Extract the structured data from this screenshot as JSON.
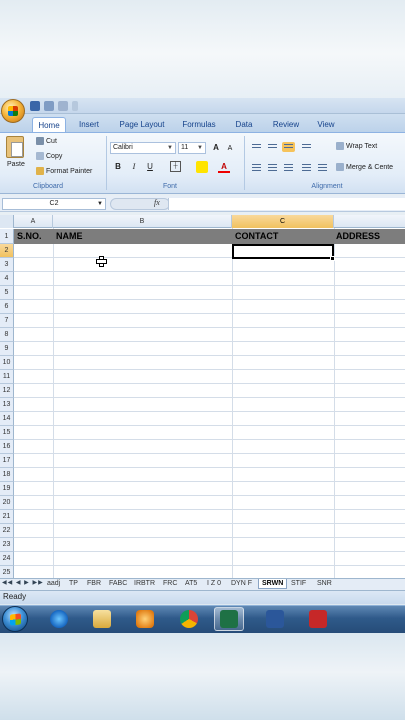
{
  "ribbon": {
    "tabs": [
      {
        "label": "Home"
      },
      {
        "label": "Insert"
      },
      {
        "label": "Page Layout"
      },
      {
        "label": "Formulas"
      },
      {
        "label": "Data"
      },
      {
        "label": "Review"
      },
      {
        "label": "View"
      }
    ],
    "clipboard": {
      "paste": "Paste",
      "cut": "Cut",
      "copy": "Copy",
      "format_painter": "Format Painter",
      "label": "Clipboard"
    },
    "font": {
      "name": "Calibri",
      "size": "11",
      "bold": "B",
      "italic": "I",
      "underline": "U",
      "label": "Font"
    },
    "alignment": {
      "wrap_text": "Wrap Text",
      "merge": "Merge & Cente",
      "label": "Alignment"
    }
  },
  "formula_bar": {
    "name_box": "C2",
    "fx": "fx"
  },
  "grid": {
    "columns": [
      "A",
      "B",
      "C"
    ],
    "rows": [
      "1",
      "2",
      "3",
      "4",
      "5",
      "6",
      "7",
      "8",
      "9",
      "10",
      "11",
      "12",
      "13",
      "14",
      "15",
      "16",
      "17",
      "18",
      "19",
      "20",
      "21",
      "22",
      "23",
      "24",
      "25"
    ],
    "header_cells": {
      "sno": "S.NO.",
      "name": "NAME",
      "contact": "CONTACT",
      "address": "ADDRESS"
    }
  },
  "sheets": [
    "aadj",
    "TP",
    "FBR",
    "FABC",
    "IRBTR",
    "FRC",
    "AT5",
    "I Z 0",
    "DYN F",
    "SRWN",
    "STIF",
    "SNR"
  ],
  "active_sheet": "SRWN",
  "status": {
    "text": "Ready"
  },
  "colors": {
    "header_fill": "#7d7d7d",
    "selected_header": "#f1c15f",
    "ribbon_text": "#15428b",
    "taskbar": "#2f5a8a"
  }
}
